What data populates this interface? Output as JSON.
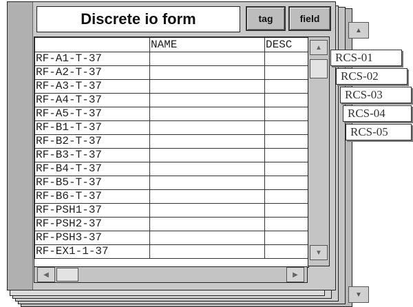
{
  "form": {
    "title": "Discrete io form",
    "tag_button": "tag",
    "field_button": "field"
  },
  "table": {
    "headers": [
      "",
      "NAME",
      "DESC"
    ],
    "rows": [
      "RF-A1-T-37",
      "RF-A2-T-37",
      "RF-A3-T-37",
      "RF-A4-T-37",
      "RF-A5-T-37",
      "RF-B1-T-37",
      "RF-B2-T-37",
      "RF-B3-T-37",
      "RF-B4-T-37",
      "RF-B5-T-37",
      "RF-B6-T-37",
      "RF-PSH1-37",
      "RF-PSH2-37",
      "RF-PSH3-37",
      "RF-EX1-1-37"
    ]
  },
  "records": [
    "RCS-01",
    "RCS-02",
    "RCS-03",
    "RCS-04",
    "RCS-05"
  ],
  "icons": {
    "up": "▲",
    "down": "▼",
    "left": "◀",
    "right": "▶"
  }
}
